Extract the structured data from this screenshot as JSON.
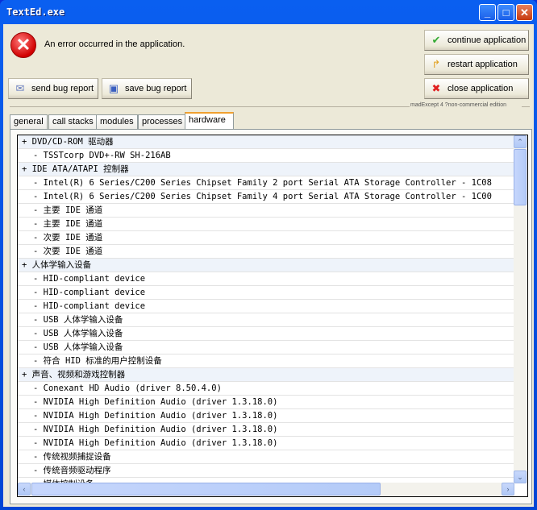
{
  "window": {
    "title": "TextEd.exe",
    "minimize": "_",
    "maximize": "□",
    "close": "✕"
  },
  "error": {
    "icon": "error-icon",
    "message": "An error occurred in the application."
  },
  "buttons": {
    "continue": "continue application",
    "restart": "restart application",
    "close": "close application",
    "send": "send bug report",
    "save": "save bug report"
  },
  "edition": "madExcept 4 ?non-commercial edition",
  "tabs": [
    {
      "label": "general"
    },
    {
      "label": "call stacks"
    },
    {
      "label": "modules"
    },
    {
      "label": "processes"
    },
    {
      "label": "hardware",
      "active": true
    }
  ],
  "rows": [
    {
      "t": "+ DVD/CD-ROM 驱动器",
      "g": true
    },
    {
      "t": "- TSSTcorp DVD+-RW SH-216AB"
    },
    {
      "t": "+ IDE ATA/ATAPI 控制器",
      "g": true
    },
    {
      "t": "- Intel(R) 6 Series/C200 Series Chipset Family 2 port Serial ATA Storage Controller - 1C08"
    },
    {
      "t": "- Intel(R) 6 Series/C200 Series Chipset Family 4 port Serial ATA Storage Controller - 1C00"
    },
    {
      "t": "- 主要 IDE 通道"
    },
    {
      "t": "- 主要 IDE 通道"
    },
    {
      "t": "- 次要 IDE 通道"
    },
    {
      "t": "- 次要 IDE 通道"
    },
    {
      "t": "+ 人体学输入设备",
      "g": true
    },
    {
      "t": "- HID-compliant device"
    },
    {
      "t": "- HID-compliant device"
    },
    {
      "t": "- HID-compliant device"
    },
    {
      "t": "- USB 人体学输入设备"
    },
    {
      "t": "- USB 人体学输入设备"
    },
    {
      "t": "- USB 人体学输入设备"
    },
    {
      "t": "- 符合 HID 标准的用户控制设备"
    },
    {
      "t": "+ 声音、视频和游戏控制器",
      "g": true
    },
    {
      "t": "- Conexant HD Audio (driver 8.50.4.0)"
    },
    {
      "t": "- NVIDIA High Definition Audio (driver 1.3.18.0)"
    },
    {
      "t": "- NVIDIA High Definition Audio (driver 1.3.18.0)"
    },
    {
      "t": "- NVIDIA High Definition Audio (driver 1.3.18.0)"
    },
    {
      "t": "- NVIDIA High Definition Audio (driver 1.3.18.0)"
    },
    {
      "t": "- 传统视频捕捉设备"
    },
    {
      "t": "- 传统音频驱动程序"
    },
    {
      "t": "- 媒体控制设备"
    }
  ],
  "scroll": {
    "vertical_position": 0,
    "horizontal_position": 0
  }
}
